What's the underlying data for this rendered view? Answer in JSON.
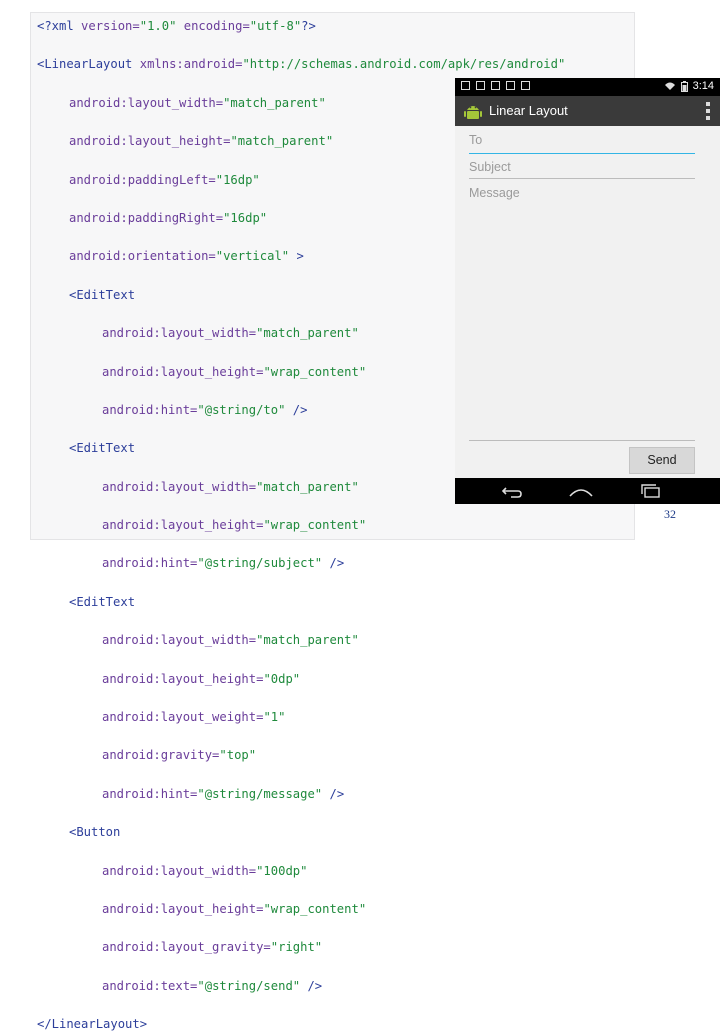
{
  "code": {
    "lines": [
      {
        "tag_open": "<?xml",
        "attrs": " version=",
        "v1": "\"1.0\"",
        "a2": " encoding=",
        "v2": "\"utf-8\"",
        "end": "?>"
      },
      {
        "tag_open": "<LinearLayout",
        "attr": " xmlns:android=",
        "value": "\"http://schemas.android.com/apk/res/android\""
      },
      {
        "attr": "android:layout_width=",
        "value": "\"match_parent\""
      },
      {
        "attr": "android:layout_height=",
        "value": "\"match_parent\""
      },
      {
        "attr": "android:paddingLeft=",
        "value": "\"16dp\""
      },
      {
        "attr": "android:paddingRight=",
        "value": "\"16dp\""
      },
      {
        "attr": "android:orientation=",
        "value": "\"vertical\"",
        "end": " >"
      },
      {
        "tag_open": "<EditText"
      },
      {
        "attr": "android:layout_width=",
        "value": "\"match_parent\""
      },
      {
        "attr": "android:layout_height=",
        "value": "\"wrap_content\""
      },
      {
        "attr": "android:hint=",
        "value": "\"@string/to\"",
        "end": " />"
      },
      {
        "tag_open": "<EditText"
      },
      {
        "attr": "android:layout_width=",
        "value": "\"match_parent\""
      },
      {
        "attr": "android:layout_height=",
        "value": "\"wrap_content\""
      },
      {
        "attr": "android:hint=",
        "value": "\"@string/subject\"",
        "end": " />"
      },
      {
        "tag_open": "<EditText"
      },
      {
        "attr": "android:layout_width=",
        "value": "\"match_parent\""
      },
      {
        "attr": "android:layout_height=",
        "value": "\"0dp\""
      },
      {
        "attr": "android:layout_weight=",
        "value": "\"1\""
      },
      {
        "attr": "android:gravity=",
        "value": "\"top\""
      },
      {
        "attr": "android:hint=",
        "value": "\"@string/message\"",
        "end": " />"
      },
      {
        "tag_open": "<Button"
      },
      {
        "attr": "android:layout_width=",
        "value": "\"100dp\""
      },
      {
        "attr": "android:layout_height=",
        "value": "\"wrap_content\""
      },
      {
        "attr": "android:layout_gravity=",
        "value": "\"right\""
      },
      {
        "attr": "android:text=",
        "value": "\"@string/send\"",
        "end": " />"
      },
      {
        "tag_open": "</LinearLayout>"
      }
    ]
  },
  "phone": {
    "status_time": "3:14",
    "app_title": "Linear Layout",
    "hint_to": "To",
    "hint_subject": "Subject",
    "hint_message": "Message",
    "send_label": "Send",
    "accent_color": "#33b5e5",
    "icons": [
      "android-app-icon",
      "overflow-menu-icon",
      "back-icon",
      "home-icon",
      "recents-icon",
      "wifi-icon",
      "battery-icon"
    ]
  },
  "page_number": "32"
}
